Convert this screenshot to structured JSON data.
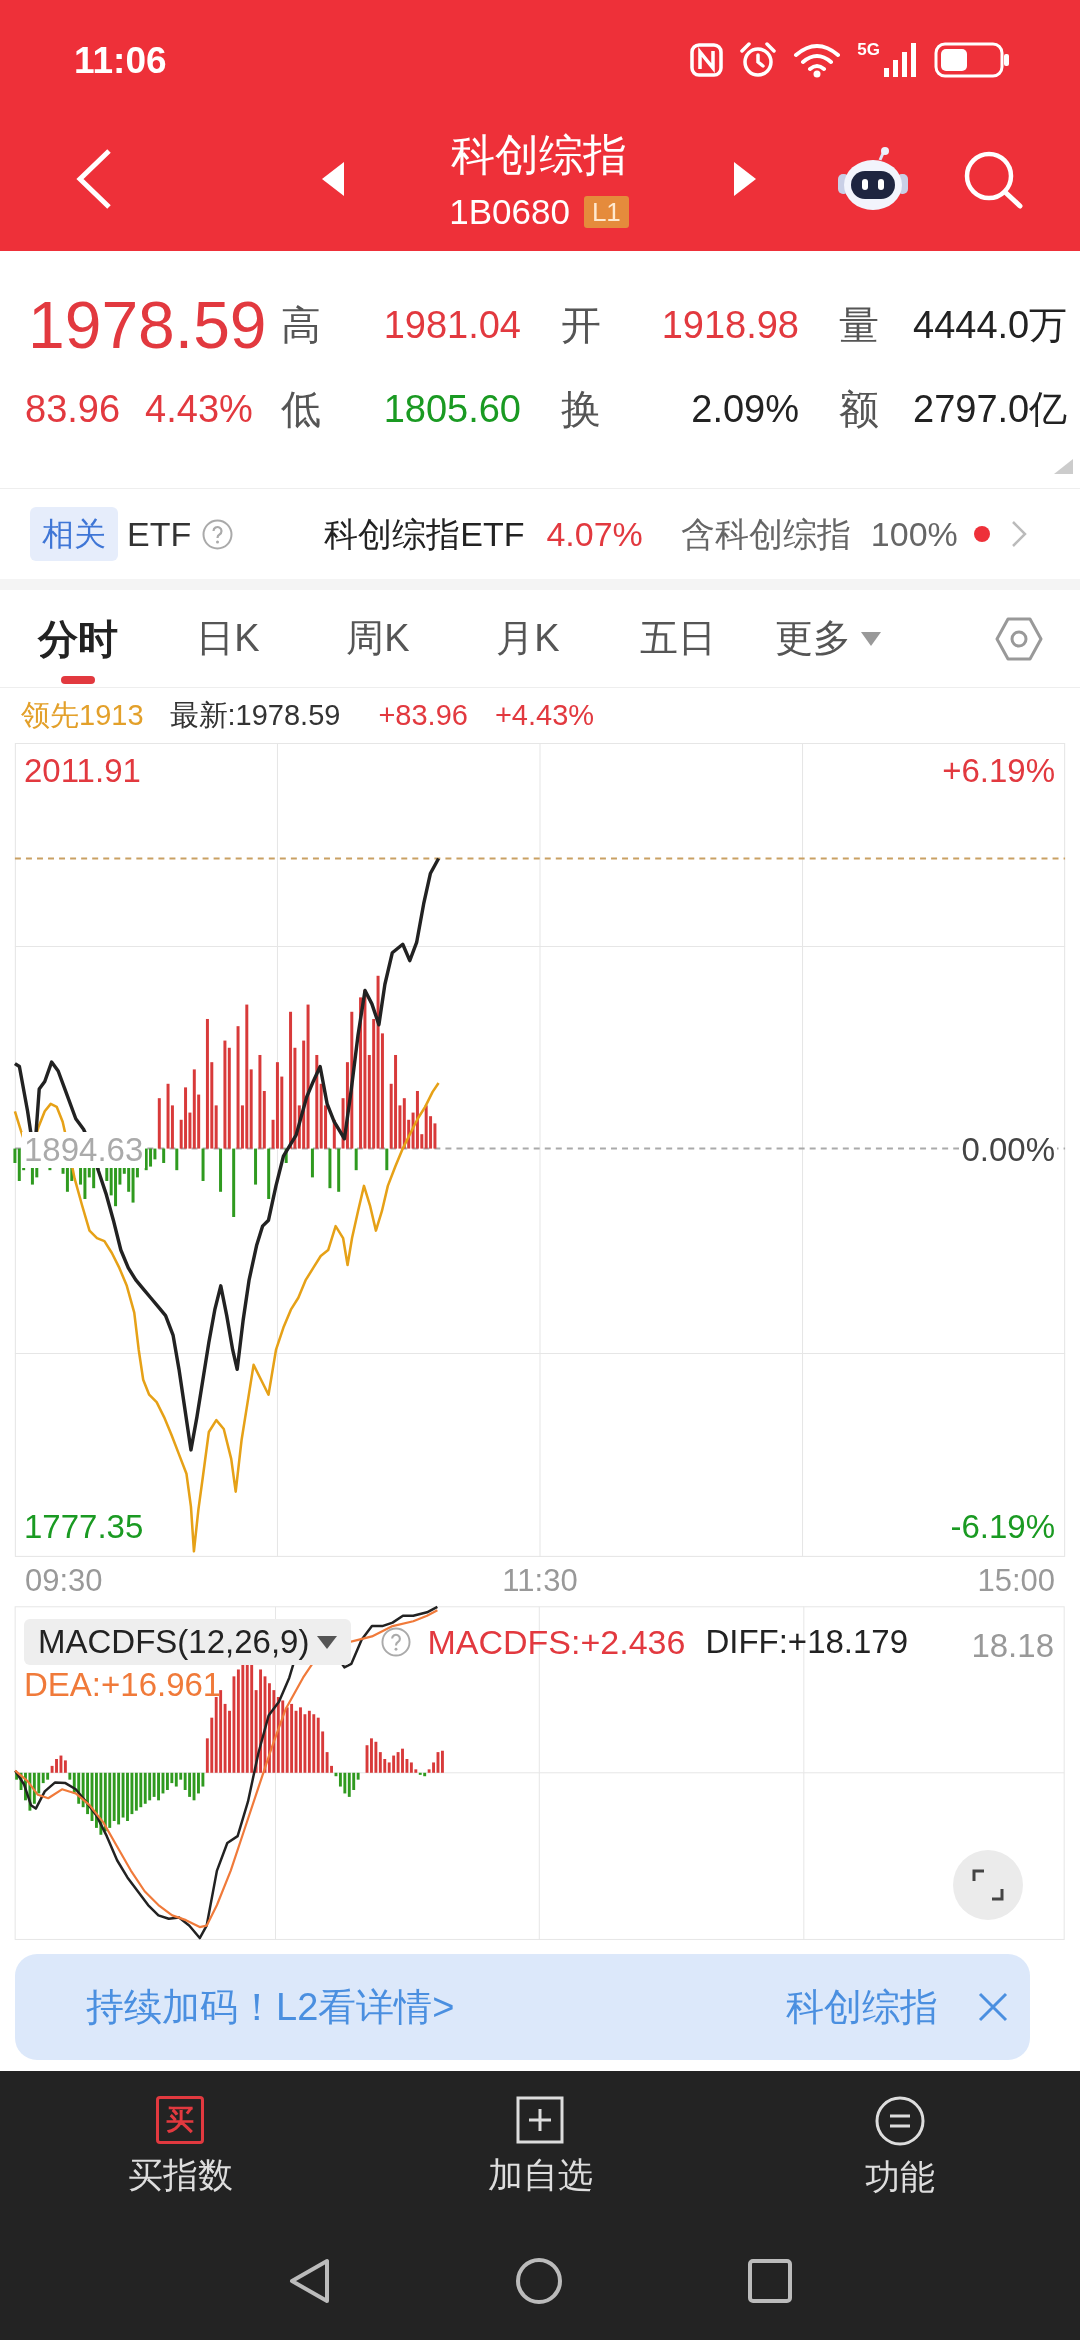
{
  "status_bar": {
    "time": "11:06",
    "network": "5G"
  },
  "header": {
    "title": "科创综指",
    "code": "1B0680",
    "level_tag": "L1"
  },
  "quote": {
    "price": "1978.59",
    "change": "83.96",
    "change_percent": "4.43%",
    "fields": [
      {
        "label": "高",
        "value": "1981.04",
        "color": "#e2393f"
      },
      {
        "label": "开",
        "value": "1918.98",
        "color": "#e2393f"
      },
      {
        "label": "量",
        "value": "4444.0万",
        "color": "#222222"
      },
      {
        "label": "低",
        "value": "1805.60",
        "color": "#1a9a22"
      },
      {
        "label": "换",
        "value": "2.09%",
        "color": "#222222"
      },
      {
        "label": "额",
        "value": "2797.0亿",
        "color": "#222222"
      }
    ]
  },
  "related_etf": {
    "tag": "相关",
    "label": "ETF",
    "name": "科创综指ETF",
    "change": "4.07%",
    "holding_label": "含科创综指",
    "holding": "100%"
  },
  "tabs": [
    {
      "label": "分时",
      "selected": true,
      "kind": "tab"
    },
    {
      "label": "日K",
      "selected": false,
      "kind": "tab"
    },
    {
      "label": "周K",
      "selected": false,
      "kind": "tab"
    },
    {
      "label": "月K",
      "selected": false,
      "kind": "tab"
    },
    {
      "label": "五日",
      "selected": false,
      "kind": "tab"
    },
    {
      "label": "更多",
      "selected": false,
      "kind": "dropdown"
    }
  ],
  "chart_info": {
    "leader": "领先1913",
    "latest": "最新:1978.59",
    "change": "+83.96",
    "change_percent": "+4.43%"
  },
  "main_chart": {
    "price_labels": [
      "2011.91",
      "1894.63",
      "1777.35"
    ],
    "percent_labels": [
      "+6.19%",
      "0.00%",
      "-6.19%"
    ],
    "time_labels": [
      "09:30",
      "11:30",
      "15:00"
    ]
  },
  "macd": {
    "indicator": "MACDFS(12,26,9)",
    "macdfs": "MACDFS:+2.436",
    "diff": "DIFF:+18.179",
    "dea": "DEA:+16.961",
    "scale": "18.18"
  },
  "banner": {
    "text": "持续加码！L2看详情>",
    "ticker": "科创综指"
  },
  "bottom_bar": [
    {
      "kind": "buy",
      "icon_text": "买",
      "label": "买指数"
    },
    {
      "kind": "add",
      "label": "加自选"
    },
    {
      "kind": "menu",
      "label": "功能"
    }
  ]
}
